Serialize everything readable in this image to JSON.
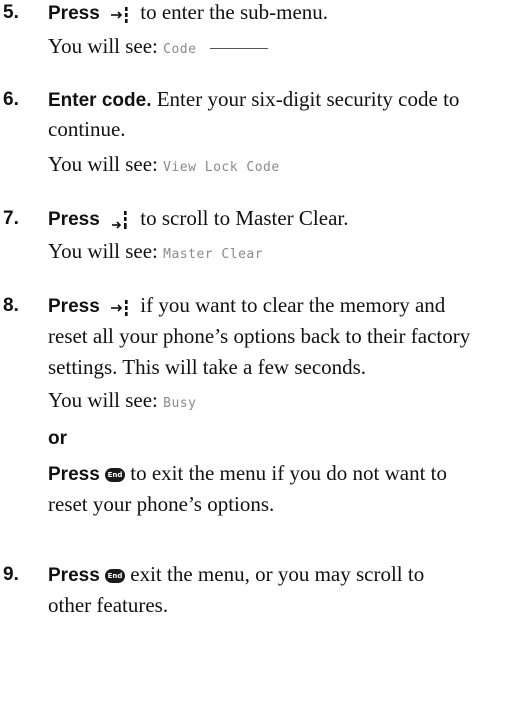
{
  "steps": [
    {
      "num": "5.",
      "action": "Press",
      "text": "to enter the sub-menu.",
      "see_label": "You will see:",
      "display": "Code",
      "icon": "select-right-icon"
    },
    {
      "num": "6.",
      "action": "Enter code.",
      "text1": "Enter your six-digit security code to",
      "text2": "continue.",
      "see_label": "You will see:",
      "display": "View Lock Code"
    },
    {
      "num": "7.",
      "action": "Press",
      "text": "to scroll to Master Clear.",
      "see_label": "You will see:",
      "display": "Master Clear",
      "icon": "scroll-down-icon"
    },
    {
      "num": "8.",
      "action": "Press",
      "text1": "if you want to clear the memory and",
      "text2": "reset all your phone’s options back to their factory",
      "text3": "settings. This will take a few seconds.",
      "see_label": "You will see:",
      "display": "Busy",
      "or": "or",
      "alt_action": "Press",
      "alt_text1": "to exit the menu if you do not want to",
      "alt_text2": "reset your phone’s options.",
      "icon": "select-right-icon",
      "end_icon": "end-key-icon",
      "end_label": "End"
    },
    {
      "num": "9.",
      "action": "Press",
      "text1": "exit the menu, or you may scroll to",
      "text2": "other features.",
      "end_icon": "end-key-icon",
      "end_label": "End"
    }
  ]
}
